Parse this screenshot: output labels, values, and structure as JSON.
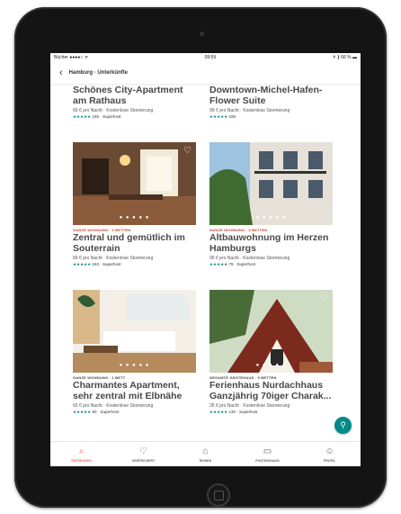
{
  "status_bar": {
    "left": "Bücher ●●●●○ ᯤ",
    "time": "09:59",
    "right": "⚘ ∦ 66 % ▬"
  },
  "search": {
    "back_glyph": "‹",
    "query": "Hamburg · Unterkünfte"
  },
  "listings": [
    {
      "title": "Schönes City-Apartment am Rathaus",
      "price": "60 € pro Nacht · Kostenlose Stornierung",
      "stars": "★★★★★",
      "rating_text": "165 · Superhost"
    },
    {
      "title": "Downtown-Michel-Hafen-Flower Suite",
      "price": "99 € pro Nacht · Kostenlose Stornierung",
      "stars": "★★★★★",
      "rating_text": "186"
    },
    {
      "type": "GANZE WOHNUNG · 2 BETTEN",
      "title": "Zentral und gemütlich im Souterrain",
      "price": "89 € pro Nacht · Kostenlose Stornierung",
      "stars": "★★★★★",
      "rating_text": "163 · Superhost",
      "dots": "● ● ● ● ●"
    },
    {
      "type": "GANZE WOHNUNG · 3 BETTEN",
      "title": "Altbauwohnung im Herzen Hamburgs",
      "price": "95 € pro Nacht · Kostenlose Stornierung",
      "stars": "★★★★★",
      "rating_text": "79 · Superhost",
      "dots": "● ● ● ● ●"
    },
    {
      "type": "GANZE WOHNUNG · 1 BETT",
      "title": "Charmantes Apartment, sehr zentral mit Elbnähe",
      "price": "65 € pro Nacht · Kostenlose Stornierung",
      "stars": "★★★★★",
      "rating_text": "80 · Superhost",
      "dots": "● ● ● ● ●"
    },
    {
      "type": "GESAMTE GÄSTEHAUS · 5 BETTEN",
      "title": "Ferienhaus Nurdachhaus Ganzjährig 70iger Charak...",
      "price": "35 € pro Nacht · Kostenlose Stornierung",
      "stars": "★★★★★",
      "rating_text": "130 · Superhost",
      "dots": "● ● ● ● ●"
    }
  ],
  "tabs": [
    {
      "label": "ENTDECKEN",
      "icon": "search-icon",
      "glyph": "⌕"
    },
    {
      "label": "GESPEICHERT",
      "icon": "heart-icon",
      "glyph": "♡"
    },
    {
      "label": "REISEN",
      "icon": "airbnb-logo-icon",
      "glyph": "⌂"
    },
    {
      "label": "POSTEINGANG",
      "icon": "message-icon",
      "glyph": "▭"
    },
    {
      "label": "PROFIL",
      "icon": "person-icon",
      "glyph": "☺"
    }
  ],
  "colors": {
    "accent": "#ff5a5f",
    "rating": "#008489",
    "map_button": "#008a8a",
    "type_red": "#c4422b"
  },
  "map_button_glyph": "⚲"
}
